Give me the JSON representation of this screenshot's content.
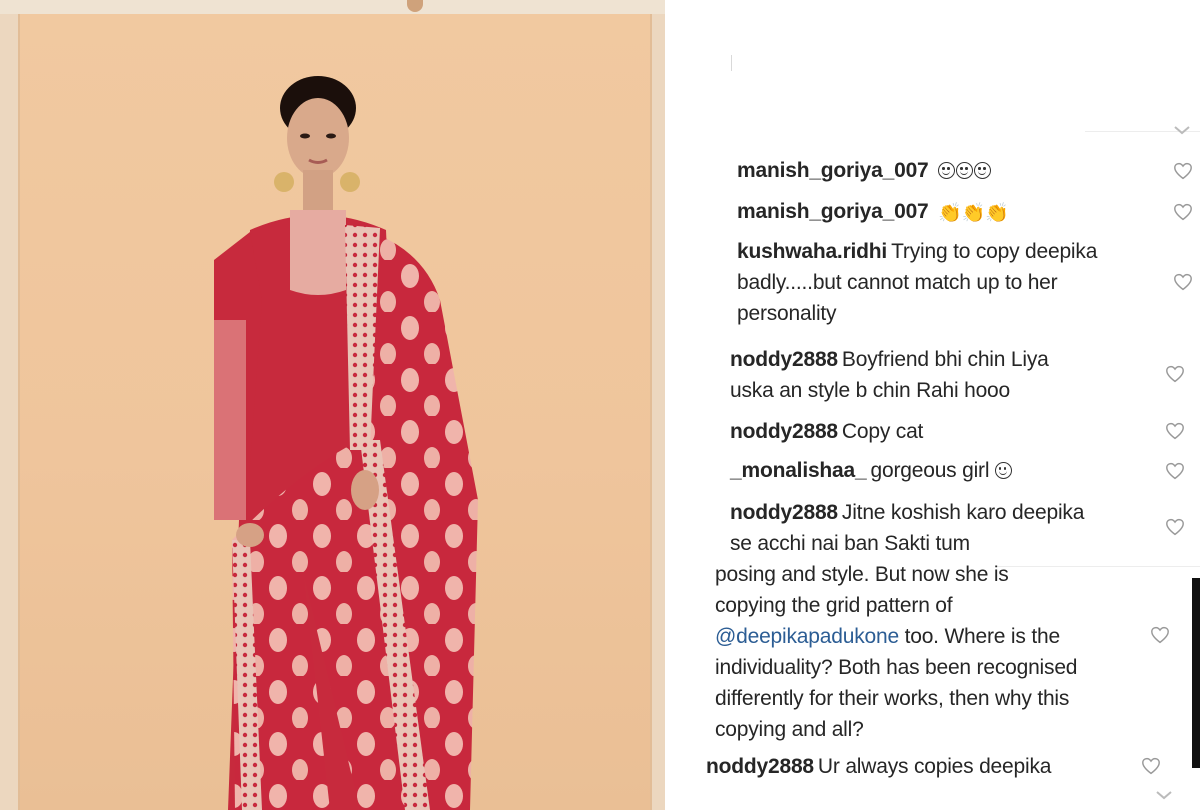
{
  "photo": {
    "alt": "woman in red embroidered suit with dupatta"
  },
  "comments": [
    {
      "user": "manish_goriya_007",
      "text": "",
      "emoji": "smile-smile-smile",
      "lines": []
    },
    {
      "user": "manish_goriya_007",
      "text": "",
      "emoji": "clap-clap-clap",
      "lines": []
    },
    {
      "user": "kushwaha.ridhi",
      "lines": [
        "Trying to copy deepika",
        "badly.....but cannot match up to her",
        "personality"
      ]
    },
    {
      "user": "noddy2888",
      "lines": [
        "Boyfriend bhi chin Liya",
        "uska an style b chin Rahi hooo"
      ]
    },
    {
      "user": "noddy2888",
      "lines": [
        "Copy cat"
      ]
    },
    {
      "user": "_monalishaa_",
      "lines": [
        "gorgeous girl"
      ]
    },
    {
      "user": "noddy2888",
      "lines": [
        "Jitne koshish karo deepika",
        "se acchi nai ban Sakti tum"
      ]
    },
    {
      "user": "",
      "lines": [
        "posing and style. But now she is",
        "copying the grid pattern of",
        "@deepikapadukone",
        "too. Where is the",
        "individuality? Both has been recognised",
        "differently for their works, then why this",
        "copying and all?"
      ]
    },
    {
      "user": "noddy2888",
      "lines": [
        "Ur always copies deepika"
      ]
    }
  ],
  "icons": {
    "heart": "heart-outline-icon",
    "chevron": "chevron-down-icon"
  },
  "colors": {
    "mention": "#2c5d94",
    "text": "#262626",
    "dress_red": "#c6283c",
    "backdrop": "#efc59c"
  }
}
